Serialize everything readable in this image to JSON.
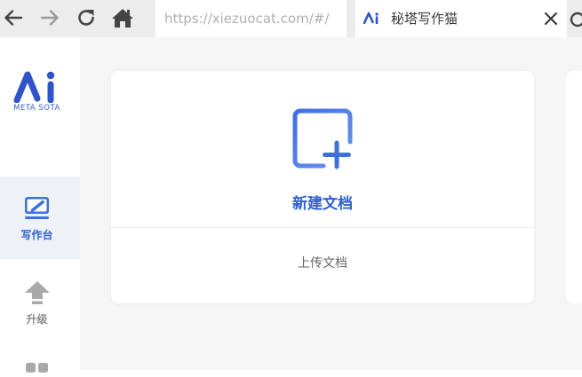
{
  "browser": {
    "address_url": "https://xiezuocat.com/#/",
    "tab_title": "秘塔写作猫",
    "icons": {
      "back": "back-arrow-icon",
      "forward": "forward-arrow-icon",
      "reload": "reload-icon",
      "home": "home-icon",
      "tab_favicon": "metasota-favicon-icon",
      "tab_close": "close-icon"
    }
  },
  "sidebar": {
    "logo_text": "META SOTA",
    "items": [
      {
        "label": "写作台",
        "icon": "edit-doc-icon",
        "active": true
      },
      {
        "label": "升级",
        "icon": "upgrade-arrow-icon",
        "active": false
      },
      {
        "label": "",
        "icon": "grid-apps-icon",
        "active": false
      }
    ]
  },
  "main": {
    "new_doc_label": "新建文档",
    "upload_label": "上传文档"
  },
  "colors": {
    "accent": "#2f5fd0",
    "logo_blue": "#3a5bc7",
    "active_bg": "#eef1f6",
    "page_bg": "#f5f5f6",
    "chrome_bg": "#ececec"
  }
}
